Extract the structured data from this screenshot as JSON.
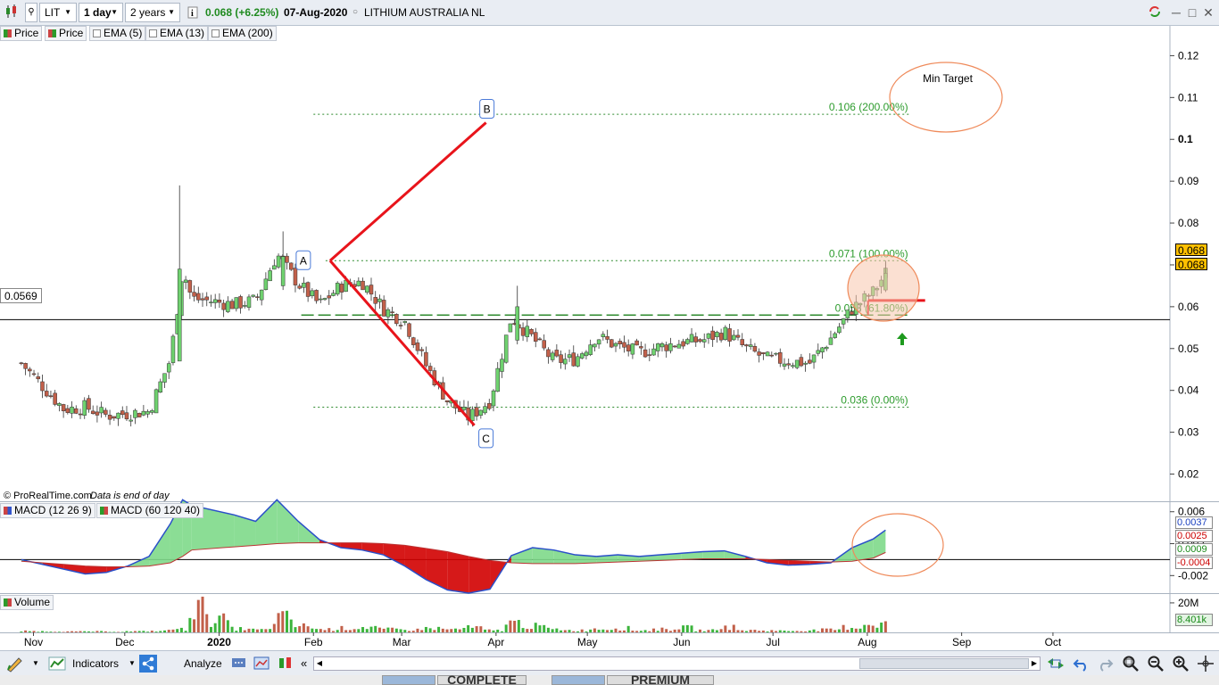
{
  "toolbar": {
    "symbol": "LIT",
    "period": "1 day",
    "range": "2 years",
    "price_change": "0.068 (+6.25%)",
    "date": "07-Aug-2020",
    "company": "LITHIUM AUSTRALIA NL",
    "minimize": "─",
    "maximize": "□",
    "close": "✕"
  },
  "legend": {
    "price1": "Price",
    "price2": "Price",
    "ema5": "EMA (5)",
    "ema13": "EMA (13)",
    "ema200": "EMA (200)"
  },
  "colors": {
    "up": "#6fd26f",
    "down": "#c2604a",
    "fib": "#2e8b2e",
    "trend": "#e8141b",
    "circle": "#ef8a5a",
    "macd_fill_green": "#7ed98a",
    "macd_fill_red": "#d10000",
    "price_tag": "#ffc000",
    "bg": "#ffffff"
  },
  "chart_data": [
    {
      "type": "candlestick",
      "title": "LITHIUM AUSTRALIA NL",
      "footer": "© ProRealTime.com",
      "footer_note": "Data is end of day",
      "x_tick_labels": [
        "Nov",
        "Dec",
        "2020",
        "Feb",
        "Mar",
        "Apr",
        "May",
        "Jun",
        "Jul",
        "Aug",
        "Sep",
        "Oct"
      ],
      "y_tick_labels": [
        "0.12",
        "0.11",
        "0.1",
        "0.09",
        "0.08",
        "0.07",
        "0.06",
        "0.05",
        "0.04",
        "0.03",
        "0.02"
      ],
      "y_ticks": [
        0.12,
        0.11,
        0.1,
        0.09,
        0.08,
        0.07,
        0.06,
        0.05,
        0.04,
        0.03,
        0.02
      ],
      "ylim": [
        0.0135,
        0.1235
      ],
      "grid": false,
      "last_price": "0.068",
      "last_price_2": "0.068",
      "horizontal_level": 0.0569,
      "horizontal_level_label": "0.0569",
      "fib_levels": [
        {
          "value": 0.106,
          "label": "0.106 (200.00%)",
          "from": "2020-02-01",
          "to": "2020-08-15"
        },
        {
          "value": 0.071,
          "label": "0.071 (100.00%)",
          "from": "2020-02-05",
          "to": "2020-08-15"
        },
        {
          "value": 0.058,
          "label": "0.058 (61.80%)",
          "from": "2020-01-28",
          "to": "2020-08-15"
        },
        {
          "value": 0.036,
          "label": "0.036 (0.00%)",
          "from": "2020-02-01",
          "to": "2020-08-15"
        }
      ],
      "points": [
        {
          "label": "A",
          "date": "2020-02-05",
          "value": 0.071
        },
        {
          "label": "B",
          "date": "2020-03-29",
          "value": 0.104
        },
        {
          "label": "C",
          "date": "2020-03-24",
          "value": 0.0325
        }
      ],
      "annotation": "Min Target",
      "prices": [
        {
          "date": "2019-10-28",
          "close": 0.0465
        },
        {
          "date": "2019-11-04",
          "close": 0.041
        },
        {
          "date": "2019-11-11",
          "close": 0.0355
        },
        {
          "date": "2019-11-18",
          "close": 0.036
        },
        {
          "date": "2019-11-25",
          "close": 0.034
        },
        {
          "date": "2019-12-02",
          "close": 0.0345
        },
        {
          "date": "2019-12-09",
          "close": 0.035
        },
        {
          "date": "2019-12-16",
          "close": 0.0475
        },
        {
          "date": "2019-12-20",
          "close": 0.069
        },
        {
          "date": "2019-12-23",
          "close": 0.062
        },
        {
          "date": "2020-01-06",
          "close": 0.0605
        },
        {
          "date": "2020-01-13",
          "close": 0.0615
        },
        {
          "date": "2020-01-20",
          "close": 0.0725
        },
        {
          "date": "2020-01-27",
          "close": 0.0655
        },
        {
          "date": "2020-02-03",
          "close": 0.0605
        },
        {
          "date": "2020-02-10",
          "close": 0.065
        },
        {
          "date": "2020-02-17",
          "close": 0.066
        },
        {
          "date": "2020-02-24",
          "close": 0.0595
        },
        {
          "date": "2020-03-02",
          "close": 0.0565
        },
        {
          "date": "2020-03-09",
          "close": 0.046
        },
        {
          "date": "2020-03-16",
          "close": 0.0375
        },
        {
          "date": "2020-03-23",
          "close": 0.0335
        },
        {
          "date": "2020-03-30",
          "close": 0.0375
        },
        {
          "date": "2020-04-06",
          "close": 0.0575
        },
        {
          "date": "2020-04-13",
          "close": 0.0525
        },
        {
          "date": "2020-04-20",
          "close": 0.047
        },
        {
          "date": "2020-04-27",
          "close": 0.0475
        },
        {
          "date": "2020-05-04",
          "close": 0.053
        },
        {
          "date": "2020-05-11",
          "close": 0.0505
        },
        {
          "date": "2020-05-18",
          "close": 0.049
        },
        {
          "date": "2020-05-25",
          "close": 0.0505
        },
        {
          "date": "2020-06-01",
          "close": 0.0515
        },
        {
          "date": "2020-06-08",
          "close": 0.052
        },
        {
          "date": "2020-06-15",
          "close": 0.054
        },
        {
          "date": "2020-06-22",
          "close": 0.05
        },
        {
          "date": "2020-06-29",
          "close": 0.0475
        },
        {
          "date": "2020-07-06",
          "close": 0.047
        },
        {
          "date": "2020-07-13",
          "close": 0.0465
        },
        {
          "date": "2020-07-20",
          "close": 0.0525
        },
        {
          "date": "2020-07-27",
          "close": 0.0595
        },
        {
          "date": "2020-08-03",
          "close": 0.0635
        },
        {
          "date": "2020-08-07",
          "close": 0.068
        }
      ]
    },
    {
      "type": "area",
      "name": "MACD",
      "legend": [
        "MACD (12 26 9)",
        "MACD (60 120 40)"
      ],
      "y_tick_labels": [
        "0.006",
        "0.002",
        "-0.002"
      ],
      "y_ticks": [
        0.006,
        0.002,
        -0.002
      ],
      "ylim": [
        -0.0042,
        0.0072
      ],
      "zero_line": 0,
      "value_tags": [
        "0.0037",
        "0.0025",
        "0.0009",
        "-0.0004"
      ],
      "value_tag_values": [
        0.0037,
        0.0025,
        0.0009,
        -0.0004
      ],
      "series": [
        {
          "name": "MACD (12 26 9)",
          "values": [
            0.0,
            -0.0006,
            -0.0012,
            -0.0018,
            -0.0016,
            -0.0008,
            0.0004,
            0.0045,
            0.0075,
            0.0068,
            0.0056,
            0.0048,
            0.0075,
            0.0048,
            0.0025,
            0.0015,
            0.0012,
            0.0006,
            -0.0008,
            -0.0025,
            -0.0038,
            -0.0042,
            -0.0037,
            0.0005,
            0.0015,
            0.0012,
            0.0006,
            0.0004,
            0.0006,
            0.0004,
            0.0006,
            0.0008,
            0.001,
            0.0011,
            0.0004,
            -0.0004,
            -0.0007,
            -0.0006,
            -0.0004,
            0.0015,
            0.0026,
            0.0037
          ]
        },
        {
          "name": "MACD (60 120 40)",
          "values": [
            -0.0002,
            -0.0004,
            -0.0006,
            -0.0008,
            -0.0009,
            -0.0009,
            -0.0008,
            -0.0004,
            0.0004,
            0.0012,
            0.0016,
            0.0018,
            0.002,
            0.0021,
            0.0021,
            0.0021,
            0.0021,
            0.002,
            0.0018,
            0.0014,
            0.001,
            0.0004,
            -0.0001,
            -0.0004,
            -0.0005,
            -0.0005,
            -0.0005,
            -0.0004,
            -0.0003,
            -0.0002,
            -0.0001,
            0.0,
            0.0001,
            0.0001,
            0.0001,
            0.0,
            -0.0001,
            -0.0002,
            -0.0003,
            -0.0002,
            0.0002,
            0.0009
          ]
        }
      ]
    },
    {
      "type": "bar",
      "name": "Volume",
      "legend": [
        "Volume"
      ],
      "y_tick_labels": [
        "20M"
      ],
      "y_ticks": [
        20000000
      ],
      "ylim": [
        0,
        26000000
      ],
      "value_tag": "8.401k",
      "series": [
        {
          "name": "Volume",
          "values": [
            1.2,
            1.0,
            0.8,
            0.9,
            0.7,
            1.0,
            1.3,
            3.0,
            23.0,
            12.0,
            3.5,
            2.5,
            14.0,
            6.0,
            3.0,
            4.0,
            5.0,
            3.0,
            2.5,
            4.0,
            3.0,
            4.5,
            2.0,
            9.0,
            6.0,
            3.0,
            2.0,
            3.5,
            4.0,
            2.0,
            3.0,
            4.5,
            2.0,
            5.0,
            2.0,
            1.8,
            1.5,
            2.0,
            2.5,
            5.0,
            8.0,
            9.5
          ]
        }
      ]
    }
  ],
  "bottombar": {
    "indicators": "Indicators",
    "analyze": "Analyze",
    "scroll_left": "«",
    "banner1": "COMPLETE",
    "banner2": "PREMIUM"
  }
}
